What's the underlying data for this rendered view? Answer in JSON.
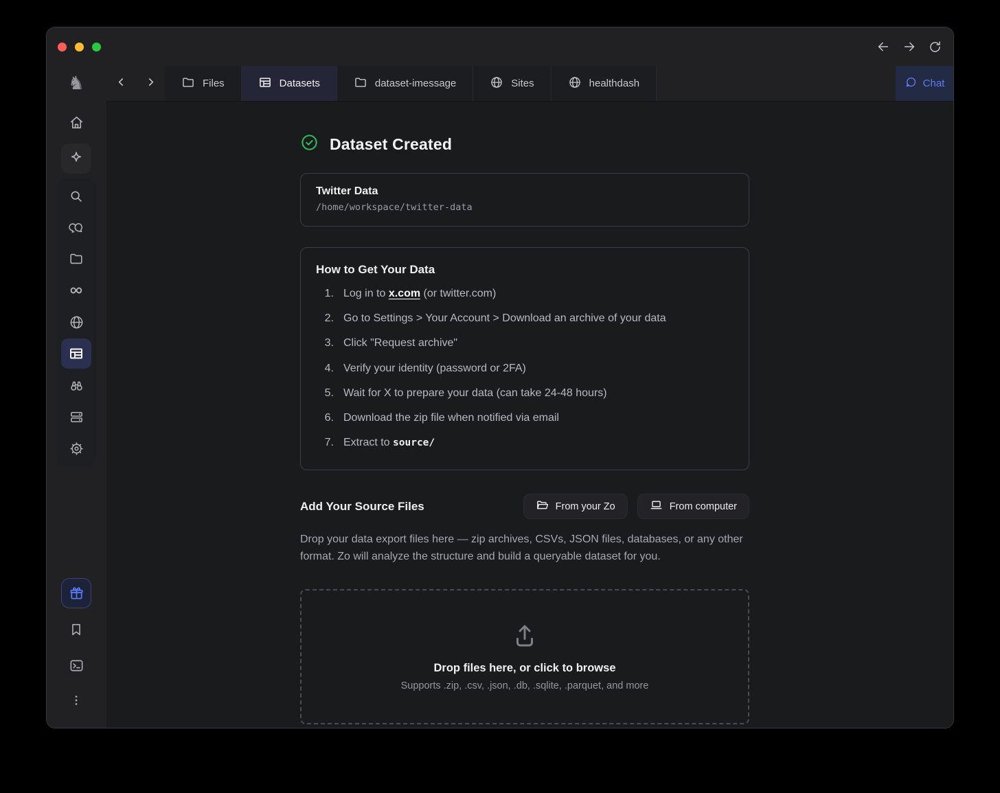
{
  "tabs": {
    "items": [
      {
        "label": "Files",
        "icon": "folder"
      },
      {
        "label": "Datasets",
        "icon": "table",
        "active": true
      },
      {
        "label": "dataset-imessage",
        "icon": "folder"
      },
      {
        "label": "Sites",
        "icon": "globe"
      },
      {
        "label": "healthdash",
        "icon": "globe"
      }
    ],
    "chat_label": "Chat"
  },
  "sidebar": {
    "items": [
      "home",
      "sparkle",
      "search",
      "messages",
      "files",
      "history",
      "browser",
      "datasets",
      "explore",
      "servers",
      "settings",
      "gift",
      "bookmarks",
      "terminal",
      "more"
    ],
    "active_item": "datasets"
  },
  "main": {
    "status_title": "Dataset Created",
    "dataset": {
      "name": "Twitter Data",
      "path": "/home/workspace/twitter-data"
    },
    "howto": {
      "title": "How to Get Your Data",
      "steps": [
        {
          "num": "1.",
          "pre": "Log in to ",
          "link": "x.com",
          "post": " (or twitter.com)"
        },
        {
          "num": "2.",
          "text": "Go to Settings > Your Account > Download an archive of your data"
        },
        {
          "num": "3.",
          "text": "Click \"Request archive\""
        },
        {
          "num": "4.",
          "text": "Verify your identity (password or 2FA)"
        },
        {
          "num": "5.",
          "text": "Wait for X to prepare your data (can take 24-48 hours)"
        },
        {
          "num": "6.",
          "text": "Download the zip file when notified via email"
        },
        {
          "num": "7.",
          "pre": "Extract to ",
          "code": "source/"
        }
      ]
    },
    "source_files": {
      "title": "Add Your Source Files",
      "button_zo": "From your Zo",
      "button_computer": "From computer",
      "description": "Drop your data export files here — zip archives, CSVs, JSON files, databases, or any other format. Zo will analyze the structure and build a queryable dataset for you.",
      "dropzone_title": "Drop files here, or click to browse",
      "dropzone_subtitle": "Supports .zip, .csv, .json, .db, .sqlite, .parquet, and more"
    }
  },
  "colors": {
    "accent_blue": "#5f7cf5",
    "success_green": "#2fbf5f",
    "traffic_close": "#ff5f57",
    "traffic_minimize": "#febc2e",
    "traffic_zoom": "#28c840"
  }
}
